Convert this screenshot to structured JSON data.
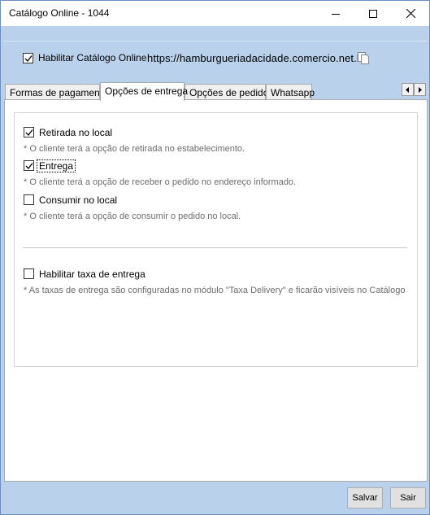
{
  "window": {
    "title": "Catálogo Online - 1044"
  },
  "header": {
    "enable_catalog_label": "Habilitar Catálogo Online",
    "enable_catalog_checked": true,
    "catalog_url": "https://hamburgueriadacidade.comercio.net.br"
  },
  "tabs": [
    {
      "label": "Formas de pagamento",
      "active": false
    },
    {
      "label": "Opções de entrega",
      "active": true
    },
    {
      "label": "Opções de pedido",
      "active": false
    },
    {
      "label": "Whatsapp",
      "active": false
    }
  ],
  "delivery_options": [
    {
      "label": "Retirada no local",
      "checked": true,
      "hint": "* O cliente terá a opção de retirada no estabelecimento."
    },
    {
      "label": "Entrega",
      "checked": true,
      "hint": "* O cliente terá a opção de receber o pedido no endereço informado."
    },
    {
      "label": "Consumir no local",
      "checked": false,
      "hint": "* O cliente terá a opção de consumir o pedido no local."
    }
  ],
  "delivery_fee": {
    "label": "Habilitar taxa de entrega",
    "checked": false,
    "hint": "* As taxas de entrega são configuradas no módulo \"Taxa Delivery\" e ficarão visíveis no Catálogo"
  },
  "footer": {
    "save_label": "Salvar",
    "exit_label": "Sair"
  }
}
